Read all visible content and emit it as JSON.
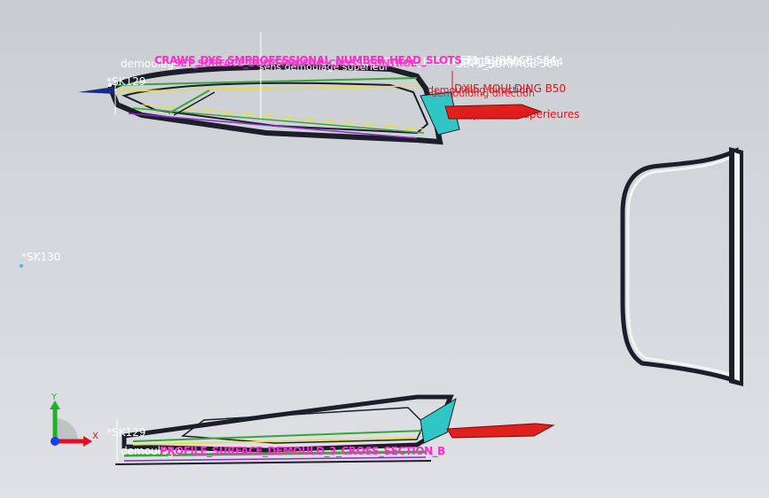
{
  "viewport": {
    "background_top": "#c9ccd1",
    "background_bottom": "#dfe1e4"
  },
  "labels": {
    "sk129_top": "*SK129",
    "sk129_bottom": "*SK129",
    "sk130": "*SK130",
    "demoulage_top": "demoulage",
    "demoulage_bottom": "demoulage",
    "demoulage_sup": "sens demoulage superieur",
    "mid_stack_1": "PLATE_SERVICE_FRONT_DOOR_DYN",
    "surface_top_1": "SET1_SURFACE 564",
    "surface_top_2": "SET1_SURFACE 564",
    "surface_top_3": "SET1_SURFACE 564",
    "magenta_top": "CRAWS_DYS_SMPROFESSIONAL_NUMBER_HEAD_SLOTS",
    "magenta_top_2": "SET_SURFACE_BODY_PROFILE_CROSS_CONTROL",
    "magenta_bottom": "PROFILE_SURFACE_DEMOULD_3_CROSS_SECTION_B",
    "red_moulding": "DXIS MOULDING B50",
    "red_demould_1": "demoulding direction",
    "red_demould_2": "demoulding direction",
    "red_depouilles": "depouilles superieures"
  },
  "triad": {
    "x_label": "X",
    "y_label": "Y",
    "x_color": "#e01020",
    "y_color": "#22b02a",
    "origin_color": "#1a3cf0"
  },
  "colors": {
    "part_dark": "#1c1e2a",
    "part_green": "#3aa43a",
    "part_yellow": "#e8e030",
    "part_purple": "#8a2ad0",
    "part_cyan": "#30c6c6",
    "part_red": "#e0201c",
    "part_white": "#f4f4f4"
  }
}
